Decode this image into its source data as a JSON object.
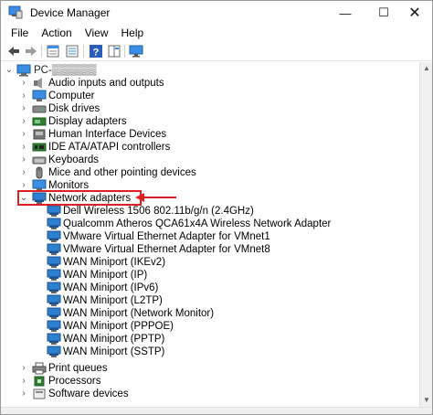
{
  "window": {
    "title": "Device Manager",
    "minimize_glyph": "—",
    "maximize_glyph": "☐",
    "close_glyph": "✕"
  },
  "menu": [
    "File",
    "Action",
    "View",
    "Help"
  ],
  "toolbar": {
    "buttons": [
      "back-arrow-icon",
      "forward-arrow-icon",
      "properties-sheet-icon",
      "show-list-icon",
      "help-icon",
      "details-pane-icon",
      "monitor-scan-icon"
    ]
  },
  "tree": {
    "root_label": "PC-▒▒▒▒▒▒",
    "categories_before": [
      {
        "label": "Audio inputs and outputs",
        "icon": "speaker-icon"
      },
      {
        "label": "Computer",
        "icon": "computer-icon"
      },
      {
        "label": "Disk drives",
        "icon": "disk-drive-icon"
      },
      {
        "label": "Display adapters",
        "icon": "display-adapter-icon"
      },
      {
        "label": "Human Interface Devices",
        "icon": "hid-icon"
      },
      {
        "label": "IDE ATA/ATAPI controllers",
        "icon": "ide-controller-icon"
      },
      {
        "label": "Keyboards",
        "icon": "keyboard-icon"
      },
      {
        "label": "Mice and other pointing devices",
        "icon": "mouse-icon"
      },
      {
        "label": "Monitors",
        "icon": "monitor-icon"
      }
    ],
    "expanded": {
      "label": "Network adapters",
      "icon": "network-adapter-icon"
    },
    "network_adapters": [
      "Dell Wireless 1506 802.11b/g/n (2.4GHz)",
      "Qualcomm Atheros QCA61x4A Wireless Network Adapter",
      "VMware Virtual Ethernet Adapter for VMnet1",
      "VMware Virtual Ethernet Adapter for VMnet8",
      "WAN Miniport (IKEv2)",
      "WAN Miniport (IP)",
      "WAN Miniport (IPv6)",
      "WAN Miniport (L2TP)",
      "WAN Miniport (Network Monitor)",
      "WAN Miniport (PPPOE)",
      "WAN Miniport (PPTP)",
      "WAN Miniport (SSTP)"
    ],
    "categories_after": [
      {
        "label": "Print queues",
        "icon": "printer-icon"
      },
      {
        "label": "Processors",
        "icon": "processor-icon"
      },
      {
        "label": "Software devices",
        "icon": "software-device-icon"
      }
    ]
  },
  "colors": {
    "highlight": "#e02020",
    "adapter_icon": "#2d7fd0"
  }
}
